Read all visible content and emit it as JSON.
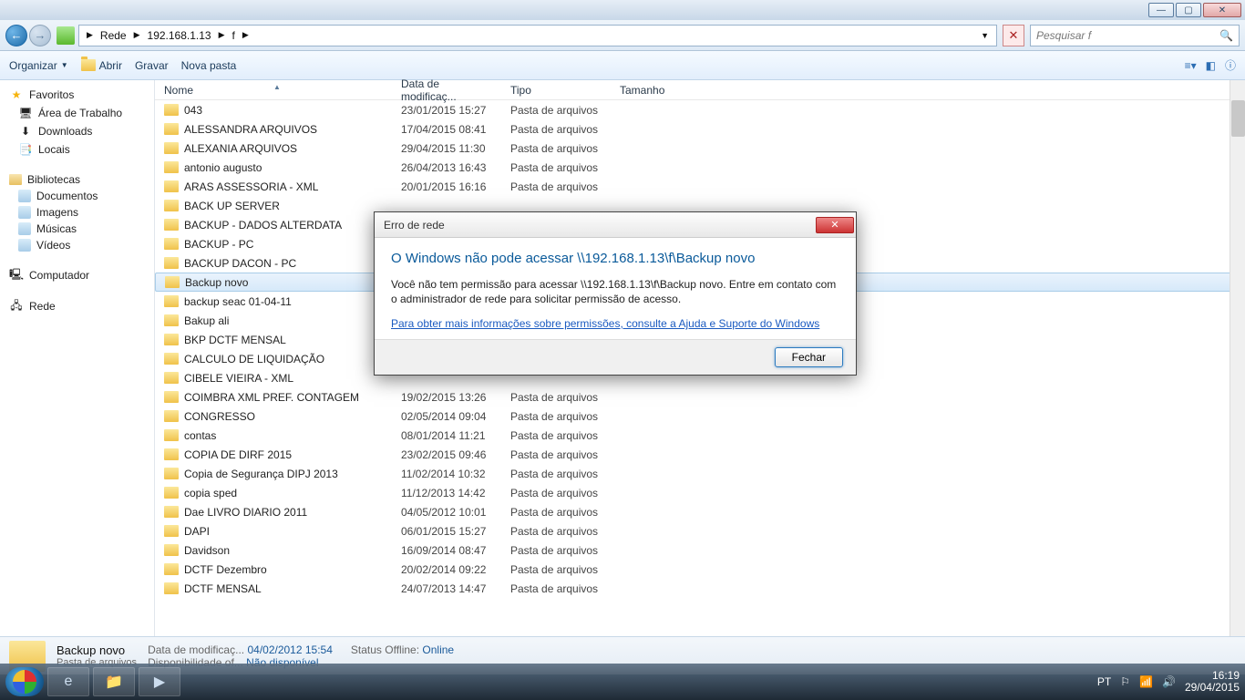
{
  "titlebar": {
    "min": "—",
    "max": "▢",
    "close": "✕"
  },
  "nav": {
    "back": "←",
    "fwd": "→",
    "crumb1": "Rede",
    "crumb2": "192.168.1.13",
    "crumb3": "f",
    "refresh": "✕",
    "search_placeholder": "Pesquisar f"
  },
  "toolbar": {
    "organize": "Organizar",
    "open": "Abrir",
    "burn": "Gravar",
    "newfolder": "Nova pasta"
  },
  "sidebar": {
    "fav": "Favoritos",
    "desktop": "Área de Trabalho",
    "downloads": "Downloads",
    "places": "Locais",
    "libs": "Bibliotecas",
    "docs": "Documentos",
    "images": "Imagens",
    "music": "Músicas",
    "videos": "Vídeos",
    "computer": "Computador",
    "network": "Rede"
  },
  "cols": {
    "name": "Nome",
    "date": "Data de modificaç...",
    "type": "Tipo",
    "size": "Tamanho"
  },
  "type_folder": "Pasta de arquivos",
  "files": [
    {
      "name": "043",
      "date": "23/01/2015 15:27"
    },
    {
      "name": "ALESSANDRA ARQUIVOS",
      "date": "17/04/2015 08:41"
    },
    {
      "name": "ALEXANIA ARQUIVOS",
      "date": "29/04/2015 11:30"
    },
    {
      "name": "antonio augusto",
      "date": "26/04/2013 16:43"
    },
    {
      "name": "ARAS ASSESSORIA - XML",
      "date": "20/01/2015 16:16"
    },
    {
      "name": "BACK UP SERVER",
      "date": ""
    },
    {
      "name": "BACKUP - DADOS ALTERDATA",
      "date": ""
    },
    {
      "name": "BACKUP - PC",
      "date": ""
    },
    {
      "name": "BACKUP DACON - PC",
      "date": ""
    },
    {
      "name": "Backup novo",
      "date": "",
      "sel": true
    },
    {
      "name": "backup seac 01-04-11",
      "date": ""
    },
    {
      "name": "Bakup ali",
      "date": ""
    },
    {
      "name": "BKP DCTF MENSAL",
      "date": ""
    },
    {
      "name": "CALCULO DE LIQUIDAÇÃO",
      "date": ""
    },
    {
      "name": "CIBELE VIEIRA - XML",
      "date": ""
    },
    {
      "name": "COIMBRA XML PREF. CONTAGEM",
      "date": "19/02/2015 13:26"
    },
    {
      "name": "CONGRESSO",
      "date": "02/05/2014 09:04"
    },
    {
      "name": "contas",
      "date": "08/01/2014 11:21"
    },
    {
      "name": "COPIA DE DIRF 2015",
      "date": "23/02/2015 09:46"
    },
    {
      "name": "Copia de Segurança DIPJ 2013",
      "date": "11/02/2014 10:32"
    },
    {
      "name": "copia sped",
      "date": "11/12/2013 14:42"
    },
    {
      "name": "Dae LIVRO DIARIO 2011",
      "date": "04/05/2012 10:01"
    },
    {
      "name": "DAPI",
      "date": "06/01/2015 15:27"
    },
    {
      "name": "Davidson",
      "date": "16/09/2014 08:47"
    },
    {
      "name": "DCTF Dezembro",
      "date": "20/02/2014 09:22"
    },
    {
      "name": "DCTF MENSAL",
      "date": "24/07/2013 14:47"
    }
  ],
  "details": {
    "title": "Backup novo",
    "sub": "Pasta de arquivos",
    "l1": "Data de modificaç...",
    "v1": "04/02/2012 15:54",
    "l2": "Disponibilidade of...",
    "v2": "Não disponível",
    "l3": "Status Offline:",
    "v3": "Online"
  },
  "dialog": {
    "title": "Erro de rede",
    "heading": "O Windows não pode acessar \\\\192.168.1.13\\f\\Backup novo",
    "msg": "Você não tem permissão para acessar \\\\192.168.1.13\\f\\Backup novo. Entre em contato com o administrador de rede para solicitar permissão de acesso.",
    "link": "Para obter mais informações sobre permissões, consulte a Ajuda e Suporte do Windows",
    "close_btn": "Fechar"
  },
  "taskbar": {
    "lang": "PT",
    "time": "16:19",
    "date": "29/04/2015"
  }
}
